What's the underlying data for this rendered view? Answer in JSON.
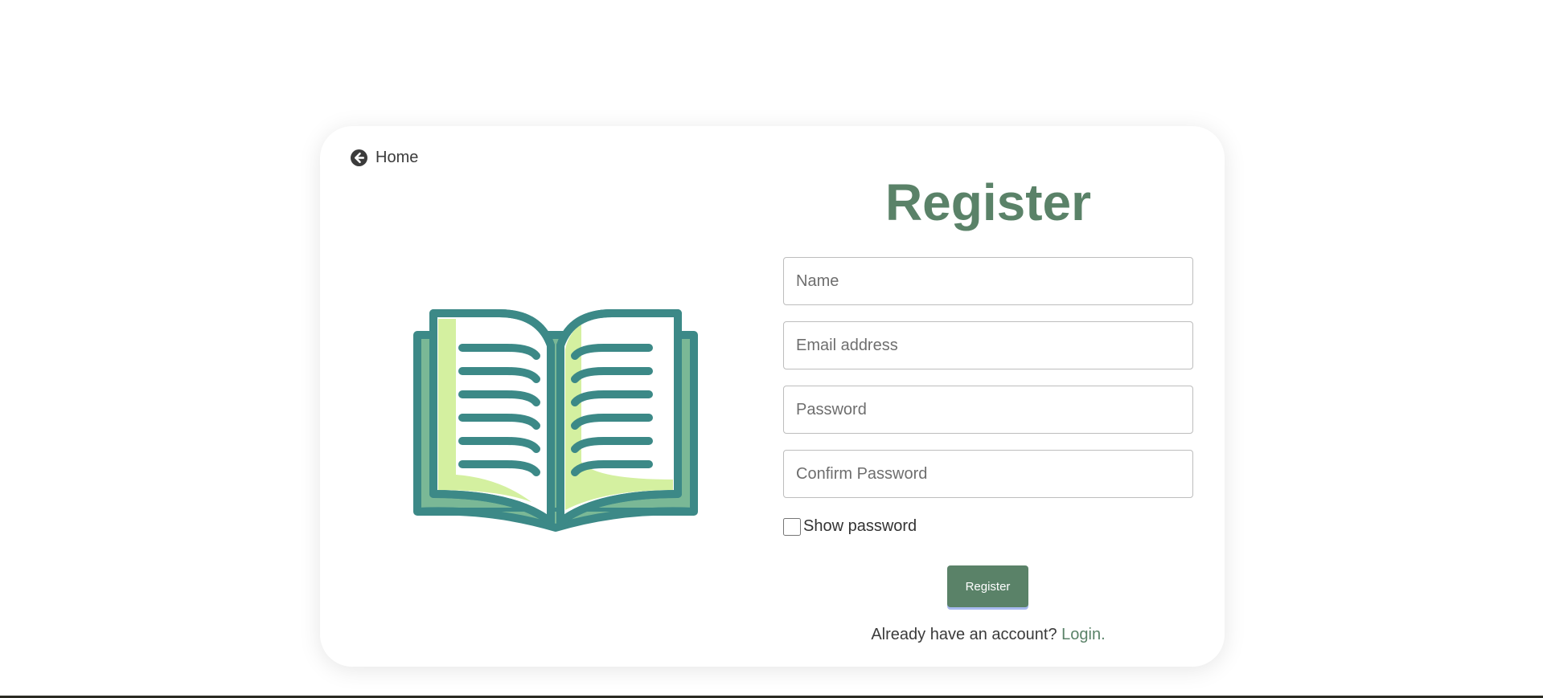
{
  "nav": {
    "home_label": "Home",
    "home_icon": "arrow-circle-left-icon"
  },
  "form": {
    "title": "Register",
    "name_placeholder": "Name",
    "email_placeholder": "Email address",
    "password_placeholder": "Password",
    "confirm_placeholder": "Confirm Password",
    "show_password_label": "Show password",
    "show_password_checked": false,
    "submit_label": "Register"
  },
  "footer": {
    "prompt": "Already have an account?",
    "login_label": "Login",
    "login_suffix": "."
  },
  "illustration": {
    "icon": "open-book-icon",
    "colors": {
      "outline": "#3c8987",
      "page_fill": "#ffffff",
      "page_shadow": "#d4f0a0",
      "cover_fill": "#7ab896"
    }
  },
  "colors": {
    "accent": "#5a8268",
    "text": "#3b3b3b"
  }
}
